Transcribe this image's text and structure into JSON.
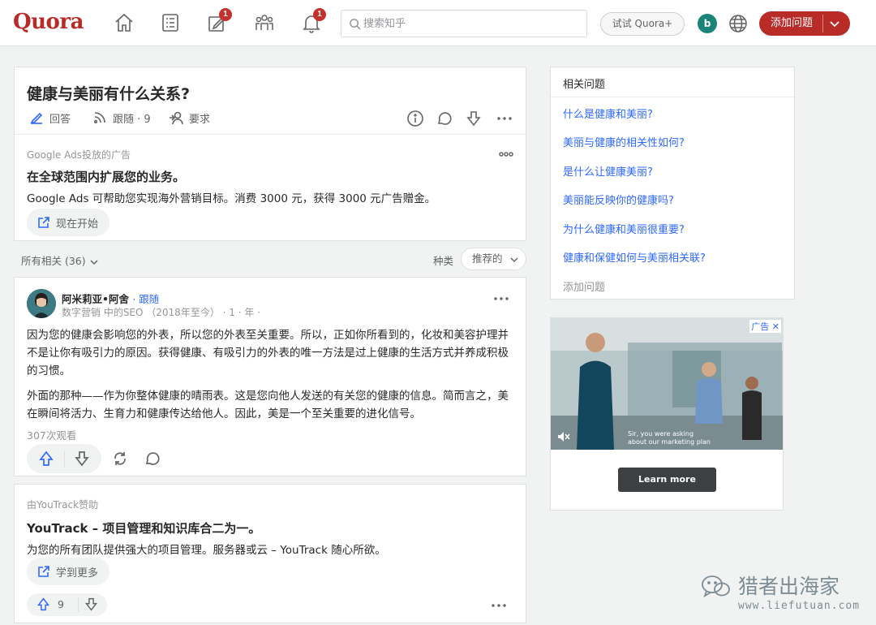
{
  "header": {
    "logo": "Quora",
    "search_placeholder": "搜索知乎",
    "try_quora": "试试 Quora+",
    "avatar_letter": "b",
    "add_question": "添加问题",
    "answer_badge": "1",
    "notif_badge": "1",
    "nav_icons": [
      "home-icon",
      "following-icon",
      "answer-icon",
      "spaces-icon",
      "notifications-icon"
    ]
  },
  "question": {
    "title": "健康与美丽有什么关系?",
    "answer_label": "回答",
    "follow_label": "跟随 · 9",
    "request_label": "要求"
  },
  "ad1": {
    "label": "Google Ads投放的广告",
    "headline": "在全球范围内扩展您的业务。",
    "text": "Google Ads 可帮助您实现海外营销目标。消费 3000 元，获得 3000 元广告赠金。",
    "cta": "现在开始"
  },
  "filter": {
    "all_related": "所有相关 (36)",
    "kind_label": "种类",
    "sort_value": "推荐的"
  },
  "answer": {
    "author": "阿米莉亚•阿舍",
    "follow": "· 跟随",
    "credential": "数字营销 中的SEO （2018年至今） · 1 · 年 ·",
    "paragraph1": "因为您的健康会影响您的外表，所以您的外表至关重要。所以，正如你所看到的，化妆和美容护理并不是让你有吸引力的原因。获得健康、有吸引力的外表的唯一方法是过上健康的生活方式并养成积极的习惯。",
    "paragraph2": "外面的那种——作为你整体健康的晴雨表。这是您向他人发送的有关您的健康的信息。简而言之，美在瞬间将活力、生育力和健康传达给他人。因此，美是一个至关重要的进化信号。",
    "views": "307次观看"
  },
  "ad2": {
    "label": "由YouTrack赞助",
    "headline": "YouTrack – 项目管理和知识库合二为一。",
    "text": "为您的所有团队提供强大的项目管理。服务器或云 – YouTrack 随心所欲。",
    "cta": "学到更多",
    "upvotes": "9"
  },
  "related": {
    "title": "相关问题",
    "items": [
      "什么是健康和美丽?",
      "美丽与健康的相关性如何?",
      "是什么让健康美丽?",
      "美丽能反映你的健康吗?",
      "为什么健康和美丽很重要?",
      "健康和保健如何与美丽相关联?"
    ],
    "add": "添加问题"
  },
  "side_ad": {
    "ad_label": "广告",
    "caption_line1": "Sir, you were asking",
    "caption_line2": "about our marketing plan",
    "cta": "Learn more"
  },
  "watermark": {
    "name": "猎者出海家",
    "url": "www.liefutuan.com"
  },
  "colors": {
    "brand": "#b92b27",
    "link": "#2e69ff",
    "background": "#f1f2f2"
  }
}
